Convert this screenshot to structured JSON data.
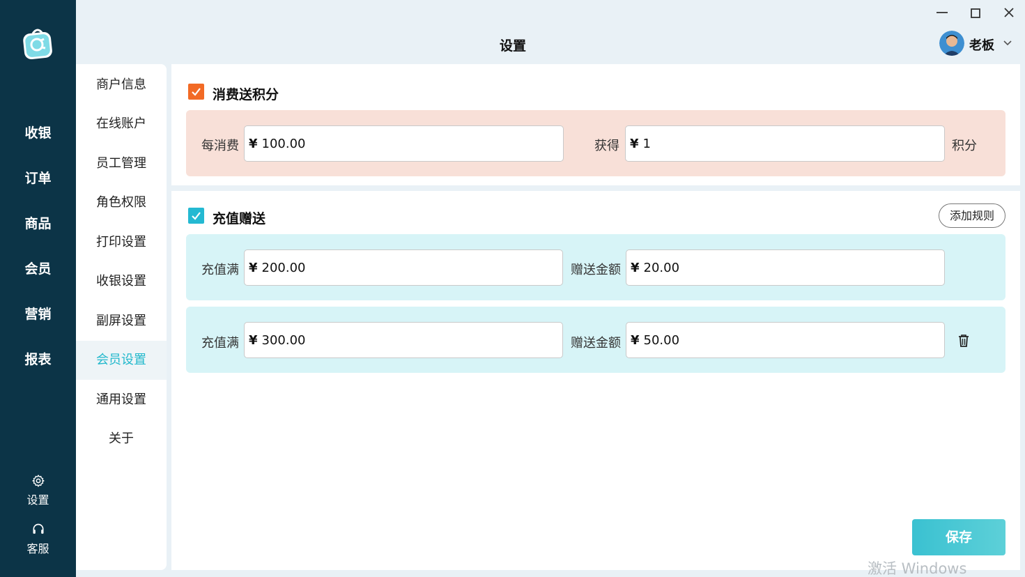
{
  "app": {
    "page_title": "设置",
    "user": {
      "name": "老板"
    }
  },
  "nav": {
    "items": [
      {
        "label": "收银"
      },
      {
        "label": "订单"
      },
      {
        "label": "商品"
      },
      {
        "label": "会员"
      },
      {
        "label": "营销"
      },
      {
        "label": "报表"
      }
    ],
    "bottom": [
      {
        "label": "设置",
        "icon": "gear-icon"
      },
      {
        "label": "客服",
        "icon": "headset-icon"
      }
    ]
  },
  "submenu": {
    "items": [
      {
        "label": "商户信息"
      },
      {
        "label": "在线账户"
      },
      {
        "label": "员工管理"
      },
      {
        "label": "角色权限"
      },
      {
        "label": "打印设置"
      },
      {
        "label": "收银设置"
      },
      {
        "label": "副屏设置"
      },
      {
        "label": "会员设置",
        "active": true
      },
      {
        "label": "通用设置"
      },
      {
        "label": "关于"
      }
    ]
  },
  "points": {
    "title": "消费送积分",
    "checked": true,
    "spend_label": "每消费",
    "spend_currency": "¥",
    "spend_value": "100.00",
    "earn_label": "获得",
    "earn_currency": "¥",
    "earn_value": "1",
    "unit": "积分"
  },
  "recharge": {
    "title": "充值赠送",
    "checked": true,
    "add_rule_label": "添加规则",
    "rules": [
      {
        "threshold_label": "充值满",
        "threshold_currency": "¥",
        "threshold": "200.00",
        "bonus_label": "赠送金额",
        "bonus_currency": "¥",
        "bonus": "20.00"
      },
      {
        "threshold_label": "充值满",
        "threshold_currency": "¥",
        "threshold": "300.00",
        "bonus_label": "赠送金额",
        "bonus_currency": "¥",
        "bonus": "50.00"
      }
    ]
  },
  "actions": {
    "save_label": "保存"
  },
  "watermark": "激活 Windows",
  "colors": {
    "nav_bg": "#0c3447",
    "accent": "#21b8cc",
    "orange": "#f26a25",
    "peach_panel": "#f8e0d8",
    "cyan_panel": "#d7f4f7"
  }
}
